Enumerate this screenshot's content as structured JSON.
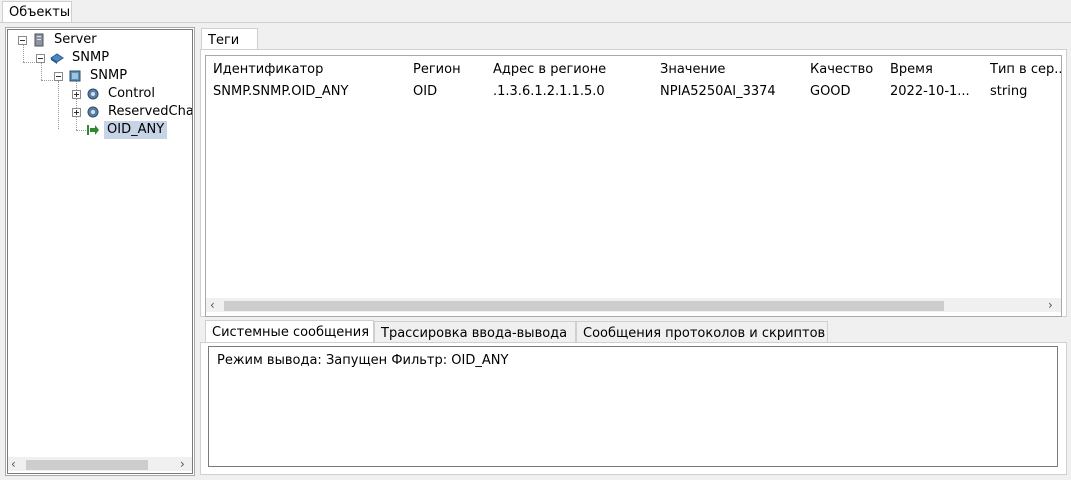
{
  "top_tab": "Объекты",
  "tree": {
    "server": "Server",
    "snmp_driver": "SNMP",
    "snmp_device": "SNMP",
    "control": "Control",
    "reserved": "ReservedCha",
    "oid_any": "OID_ANY"
  },
  "tags_tab": "Теги",
  "table": {
    "columns": [
      "Идентификатор",
      "Регион",
      "Адрес в регионе",
      "Значение",
      "Качество",
      "Время",
      "Тип в сер..."
    ],
    "rows": [
      [
        "SNMP.SNMP.OID_ANY",
        "OID",
        ".1.3.6.1.2.1.1.5.0",
        "NPIA5250AI_3374",
        "GOOD",
        "2022-10-1...",
        "string"
      ]
    ]
  },
  "bottom_tabs": [
    "Системные сообщения",
    "Трассировка ввода-вывода",
    "Сообщения протоколов и скриптов"
  ],
  "log_text": "Режим вывода: Запущен Фильтр: OID_ANY",
  "colors": {
    "selection": "#c5d4e6",
    "border": "#a9a9a9"
  }
}
